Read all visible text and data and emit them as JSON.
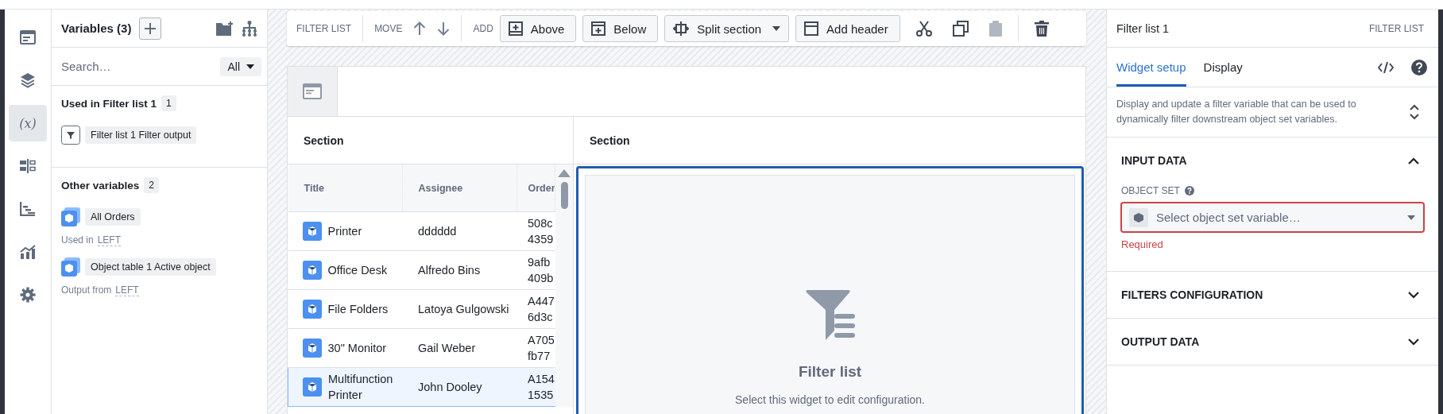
{
  "rail": [
    {
      "kind": "page",
      "selected": false
    },
    {
      "kind": "layers",
      "selected": false
    },
    {
      "kind": "variable",
      "label": "(x)",
      "selected": true
    },
    {
      "kind": "layout",
      "selected": false
    },
    {
      "kind": "steps",
      "selected": false
    },
    {
      "kind": "chart",
      "selected": false
    },
    {
      "kind": "settings",
      "selected": false
    }
  ],
  "variables_panel": {
    "title": "Variables (3)",
    "search": {
      "placeholder": "Search…"
    },
    "filter": {
      "value": "All"
    },
    "groups": [
      {
        "title": "Used in Filter list 1",
        "count": "1",
        "items": [
          {
            "kind": "filter",
            "name": "Filter list 1 Filter output"
          }
        ]
      },
      {
        "title": "Other variables",
        "count": "2",
        "items": [
          {
            "kind": "object",
            "name": "All Orders",
            "note": "Used in",
            "link": "LEFT"
          },
          {
            "kind": "object",
            "name": "Object table 1 Active object",
            "note": "Output from",
            "link": "LEFT"
          }
        ]
      }
    ]
  },
  "toolbar": {
    "widget_type": "FILTER LIST",
    "move_label": "MOVE",
    "add_label": "ADD",
    "buttons": [
      {
        "kind": "above",
        "label": "Above"
      },
      {
        "kind": "below",
        "label": "Below"
      },
      {
        "kind": "split",
        "label": "Split section"
      },
      {
        "kind": "header",
        "label": "Add header"
      }
    ],
    "actions": [
      {
        "kind": "cut",
        "disabled": false
      },
      {
        "kind": "copy",
        "disabled": false
      },
      {
        "kind": "paste",
        "disabled": true
      },
      {
        "kind": "delete",
        "disabled": false
      }
    ]
  },
  "sections": [
    {
      "title": "Section"
    },
    {
      "title": "Section"
    }
  ],
  "table": {
    "columns": [
      "Title",
      "Assignee",
      "Order"
    ],
    "rows": [
      {
        "title": "Printer",
        "assignee": "dddddd",
        "order": [
          "508c",
          "4359"
        ],
        "selected": false
      },
      {
        "title": "Office Desk",
        "assignee": "Alfredo Bins",
        "order": [
          "9afb",
          "409b"
        ],
        "selected": false
      },
      {
        "title": "File Folders",
        "assignee": "Latoya Gulgowski",
        "order": [
          "A447",
          "6d3c"
        ],
        "selected": false
      },
      {
        "title": "30\" Monitor",
        "assignee": "Gail Weber",
        "order": [
          "A705",
          "fb77"
        ],
        "selected": false
      },
      {
        "title": "Multifunction Printer",
        "assignee": "John Dooley",
        "order": [
          "A154",
          "1535"
        ],
        "selected": true
      }
    ]
  },
  "widget": {
    "selected": true,
    "title": "Filter list",
    "subtitle": "Select this widget to edit configuration."
  },
  "config_panel": {
    "title": "Filter list 1",
    "type": "FILTER LIST",
    "tabs": [
      {
        "label": "Widget setup",
        "selected": true
      },
      {
        "label": "Display",
        "selected": false
      }
    ],
    "description": "Display and update a filter variable that can be used to dynamically filter downstream object set variables.",
    "sections": [
      {
        "title": "INPUT DATA",
        "expanded": true,
        "field": {
          "label": "OBJECT SET",
          "placeholder": "Select object set variable…",
          "error": "Required"
        }
      },
      {
        "title": "FILTERS CONFIGURATION",
        "expanded": false
      },
      {
        "title": "OUTPUT DATA",
        "expanded": false
      }
    ]
  }
}
